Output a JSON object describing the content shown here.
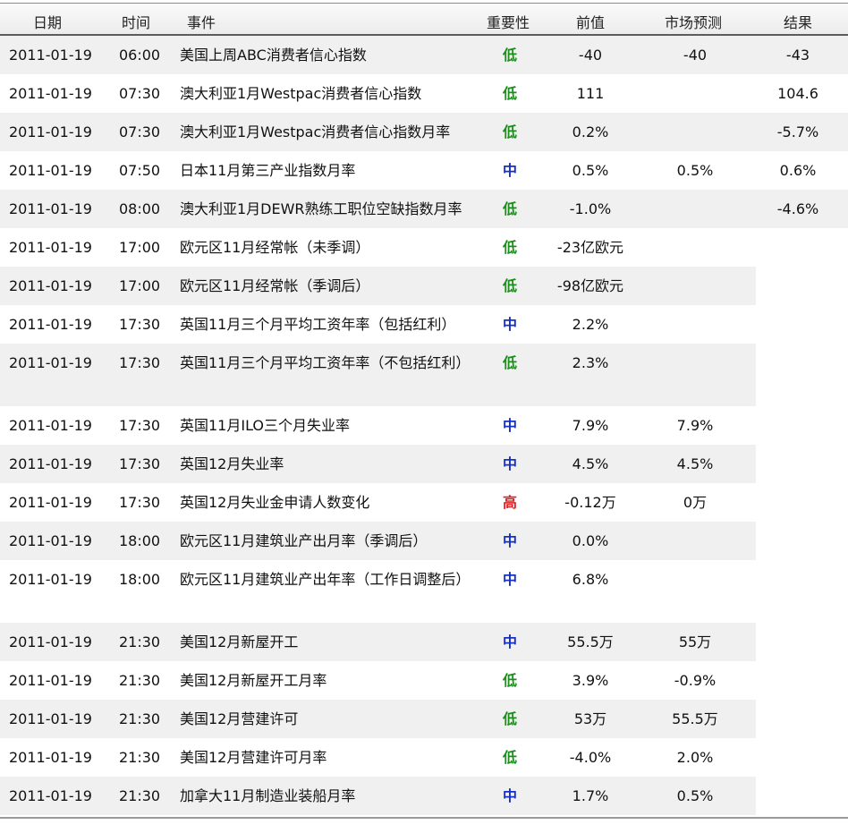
{
  "header": {
    "date": "日期",
    "time": "时间",
    "event": "事件",
    "importance": "重要性",
    "previous": "前值",
    "forecast": "市场预测",
    "result": "结果"
  },
  "colors": {
    "low": "#1a8f1a",
    "medium": "#1530c8",
    "high": "#e01f1f"
  },
  "rows": [
    {
      "date": "2011-01-19",
      "time": "06:00",
      "event": "美国上周ABC消费者信心指数",
      "importance": "低",
      "previous": "-40",
      "forecast": "-40",
      "result": "-43"
    },
    {
      "date": "2011-01-19",
      "time": "07:30",
      "event": "澳大利亚1月Westpac消费者信心指数",
      "importance": "低",
      "previous": "111",
      "forecast": "",
      "result": "104.6"
    },
    {
      "date": "2011-01-19",
      "time": "07:30",
      "event": "澳大利亚1月Westpac消费者信心指数月率",
      "importance": "低",
      "previous": "0.2%",
      "forecast": "",
      "result": "-5.7%"
    },
    {
      "date": "2011-01-19",
      "time": "07:50",
      "event": "日本11月第三产业指数月率",
      "importance": "中",
      "previous": "0.5%",
      "forecast": "0.5%",
      "result": "0.6%"
    },
    {
      "date": "2011-01-19",
      "time": "08:00",
      "event": "澳大利亚1月DEWR熟练工职位空缺指数月率",
      "importance": "低",
      "previous": "-1.0%",
      "forecast": "",
      "result": "-4.6%"
    },
    {
      "date": "2011-01-19",
      "time": "17:00",
      "event": "欧元区11月经常帐（未季调）",
      "importance": "低",
      "previous": "-23亿欧元",
      "forecast": "",
      "result": ""
    },
    {
      "date": "2011-01-19",
      "time": "17:00",
      "event": "欧元区11月经常帐（季调后）",
      "importance": "低",
      "previous": "-98亿欧元",
      "forecast": "",
      "result": ""
    },
    {
      "date": "2011-01-19",
      "time": "17:30",
      "event": "英国11月三个月平均工资年率（包括红利）",
      "importance": "中",
      "previous": "2.2%",
      "forecast": "",
      "result": ""
    },
    {
      "date": "2011-01-19",
      "time": "17:30",
      "event": "英国11月三个月平均工资年率（不包括红利）",
      "importance": "低",
      "previous": "2.3%",
      "forecast": "",
      "result": ""
    },
    {
      "date": "2011-01-19",
      "time": "17:30",
      "event": "英国11月ILO三个月失业率",
      "importance": "中",
      "previous": "7.9%",
      "forecast": "7.9%",
      "result": ""
    },
    {
      "date": "2011-01-19",
      "time": "17:30",
      "event": "英国12月失业率",
      "importance": "中",
      "previous": "4.5%",
      "forecast": "4.5%",
      "result": ""
    },
    {
      "date": "2011-01-19",
      "time": "17:30",
      "event": "英国12月失业金申请人数变化",
      "importance": "高",
      "previous": "-0.12万",
      "forecast": "0万",
      "result": ""
    },
    {
      "date": "2011-01-19",
      "time": "18:00",
      "event": "欧元区11月建筑业产出月率（季调后）",
      "importance": "中",
      "previous": "0.0%",
      "forecast": "",
      "result": ""
    },
    {
      "date": "2011-01-19",
      "time": "18:00",
      "event": "欧元区11月建筑业产出年率（工作日调整后）",
      "importance": "中",
      "previous": "6.8%",
      "forecast": "",
      "result": ""
    },
    {
      "date": "2011-01-19",
      "time": "21:30",
      "event": "美国12月新屋开工",
      "importance": "中",
      "previous": "55.5万",
      "forecast": "55万",
      "result": ""
    },
    {
      "date": "2011-01-19",
      "time": "21:30",
      "event": "美国12月新屋开工月率",
      "importance": "低",
      "previous": "3.9%",
      "forecast": "-0.9%",
      "result": ""
    },
    {
      "date": "2011-01-19",
      "time": "21:30",
      "event": "美国12月营建许可",
      "importance": "低",
      "previous": "53万",
      "forecast": "55.5万",
      "result": ""
    },
    {
      "date": "2011-01-19",
      "time": "21:30",
      "event": "美国12月营建许可月率",
      "importance": "低",
      "previous": "-4.0%",
      "forecast": "2.0%",
      "result": ""
    },
    {
      "date": "2011-01-19",
      "time": "21:30",
      "event": "加拿大11月制造业装船月率",
      "importance": "中",
      "previous": "1.7%",
      "forecast": "0.5%",
      "result": ""
    }
  ]
}
